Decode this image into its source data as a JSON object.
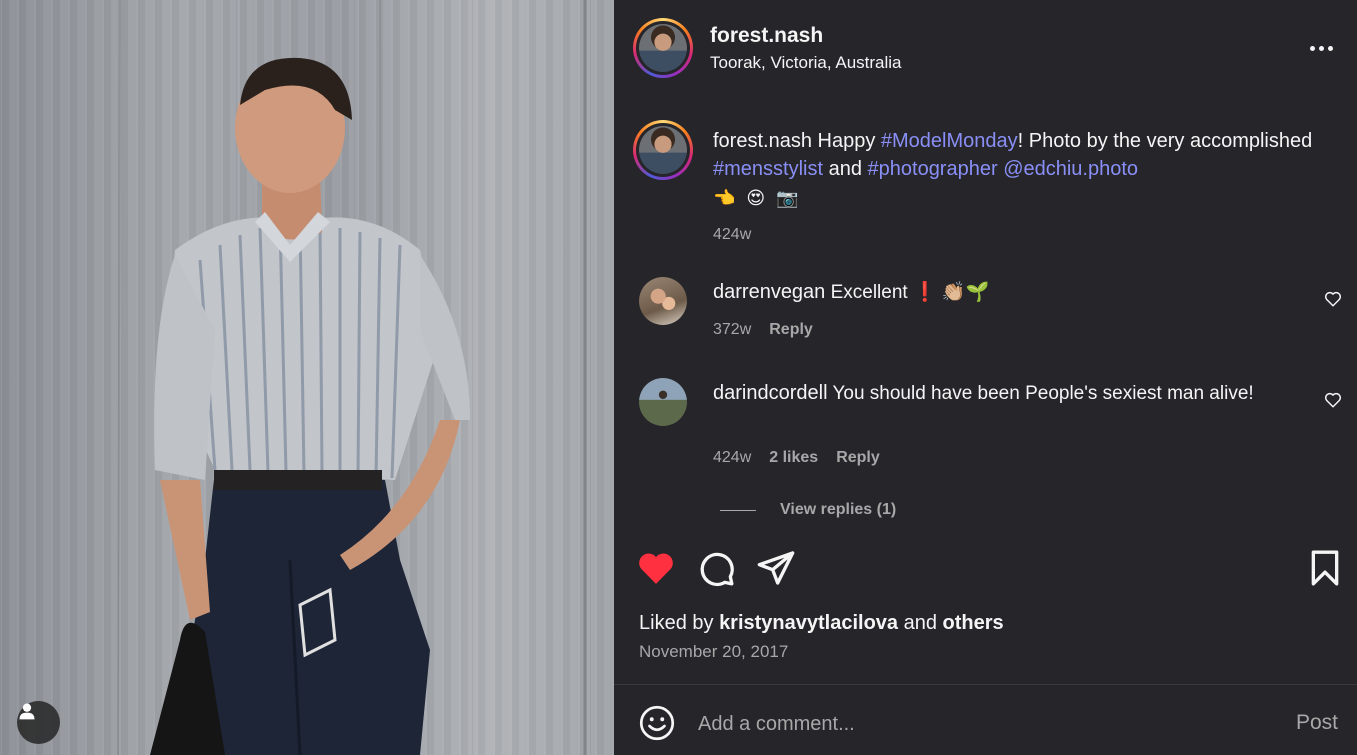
{
  "post": {
    "username": "forest.nash",
    "location": "Toorak, Victoria, Australia",
    "more_icon": "more-horizontal-icon"
  },
  "caption": {
    "username": "forest.nash",
    "text_1": " Happy ",
    "tag_1": "#ModelMonday",
    "text_2": "! Photo by the very accomplished ",
    "tag_2": "#mensstylist",
    "text_3": " and ",
    "tag_3": "#photographer",
    "text_4": " ",
    "mention": "@edchiu.photo",
    "emojis": "👈 😍 📷",
    "age": "424w"
  },
  "comments": [
    {
      "username": "darrenvegan",
      "text": " Excellent ❗ 👏🏼🌱",
      "age": "372w",
      "likes": "",
      "reply_label": "Reply"
    },
    {
      "username": "darindcordell",
      "text": " You should have been People's sexiest man alive!",
      "age": "424w",
      "likes": "2 likes",
      "reply_label": "Reply"
    }
  ],
  "view_replies": "View replies (1)",
  "likes": {
    "prefix": "Liked by ",
    "user": "kristynavytlacilova",
    "middle": " and ",
    "others": "others"
  },
  "date": "November 20, 2017",
  "composer": {
    "placeholder": "Add a comment...",
    "post_label": "Post"
  },
  "colors": {
    "background": "#25252a",
    "link": "#8a8ff6",
    "like_red": "#ff3040",
    "muted": "#a8a8a8"
  }
}
